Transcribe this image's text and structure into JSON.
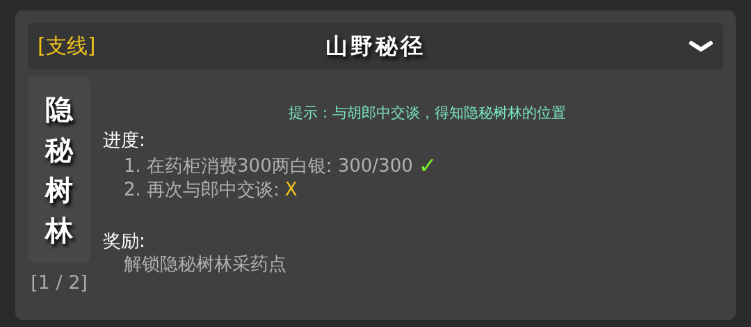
{
  "header": {
    "tag": "[支线]",
    "title": "山野秘径",
    "expanded": true
  },
  "quest_name": "隐秘树林",
  "page": "[1 / 2]",
  "hint": "提示：与胡郎中交谈，得知隐秘树林的位置",
  "progress_label": "进度:",
  "objectives": [
    {
      "text": "1. 在药柜消费300两白银: 300/300",
      "done": true,
      "mark": "✓"
    },
    {
      "text": "2. 再次与郎中交谈:",
      "done": false,
      "mark": "X"
    }
  ],
  "reward_label": "奖励:",
  "rewards": [
    "解锁隐秘树林采药点"
  ]
}
